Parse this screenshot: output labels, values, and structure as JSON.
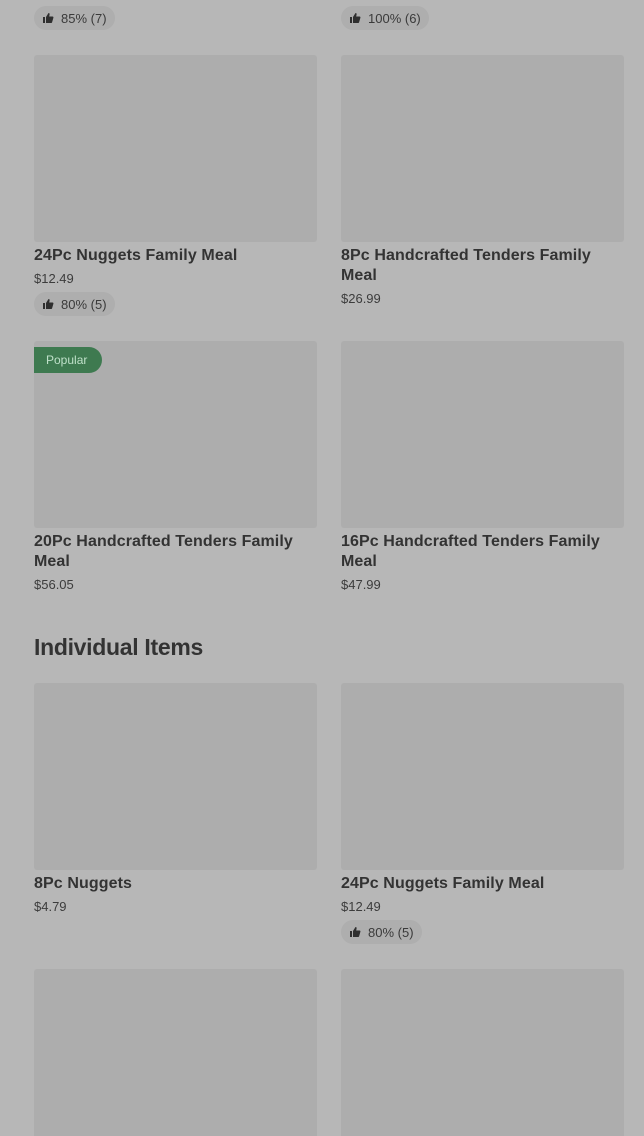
{
  "top_row": {
    "left_rating": "85% (7)",
    "right_rating": "100% (6)"
  },
  "family_meals": [
    {
      "name": "24Pc Nuggets Family Meal",
      "price": "$12.49",
      "rating": "80% (5)"
    },
    {
      "name": "8Pc Handcrafted Tenders Family Meal",
      "price": "$26.99"
    },
    {
      "name": "20Pc Handcrafted Tenders Family Meal",
      "price": "$56.05",
      "tag": "Popular"
    },
    {
      "name": "16Pc Handcrafted Tenders Family Meal",
      "price": "$47.99"
    }
  ],
  "individual_section": {
    "title": "Individual Items",
    "items": [
      {
        "name": "8Pc Nuggets",
        "price": "$4.79"
      },
      {
        "name": "24Pc Nuggets Family Meal",
        "price": "$12.49",
        "rating": "80% (5)"
      }
    ]
  },
  "icons": {
    "rating": "thumbs-up-icon"
  },
  "colors": {
    "popular_badge_bg": "#3e7a50",
    "popular_badge_text": "#bfe0c9"
  }
}
